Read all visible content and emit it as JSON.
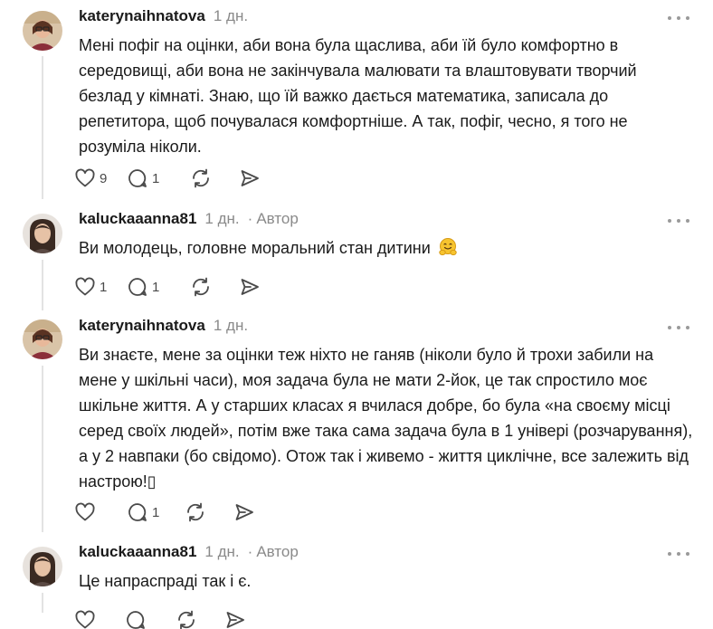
{
  "colors": {
    "text": "#1a1a1a",
    "muted": "#8a8a8a",
    "icon": "#4a4a4a",
    "thread_line": "#e3e3e3"
  },
  "comments": [
    {
      "username": "katerynaihnatova",
      "time": "1 дн.",
      "body": "Мені пофіг на оцінки, аби вона була щаслива, аби їй було комфортно в середовищі, аби вона не закінчувала малювати та влаштовувати творчий безлад у кімнаті. Знаю, що їй важко дається математика, записала до репетитора, щоб почувалася комфортніше. А так, пофіг, чесно, я того не розуміла ніколи.",
      "likes": "9",
      "replies": "1"
    },
    {
      "username": "kaluckaaanna81",
      "time": "1 дн.",
      "separator": "·",
      "author_badge": "Автор",
      "body": "Ви молодець, головне моральний стан дитини",
      "emoji": "hugging-face-emoji",
      "likes": "1",
      "replies": "1"
    },
    {
      "username": "katerynaihnatova",
      "time": "1 дн.",
      "body": "Ви знаєте, мене за оцінки теж ніхто не ганяв (ніколи було й трохи забили на мене у шкільні часи), моя задача була не мати 2-йок, це так спростило моє шкільне життя. А у старших класах я вчилася добре, бо була «на своєму місці серед своїх людей», потім вже така сама задача була в 1 універі (розчарування), а у 2 навпаки (бо свідомо). Отож так і живемо - життя циклічне, все залежить від настрою!▯",
      "likes": "",
      "replies": "1"
    },
    {
      "username": "kaluckaaanna81",
      "time": "1 дн.",
      "separator": "·",
      "author_badge": "Автор",
      "body": "Це напраспраді так і є.",
      "likes": "",
      "replies": ""
    }
  ],
  "icons": [
    "heart-icon",
    "comment-icon",
    "repost-icon",
    "share-icon",
    "more-icon"
  ]
}
